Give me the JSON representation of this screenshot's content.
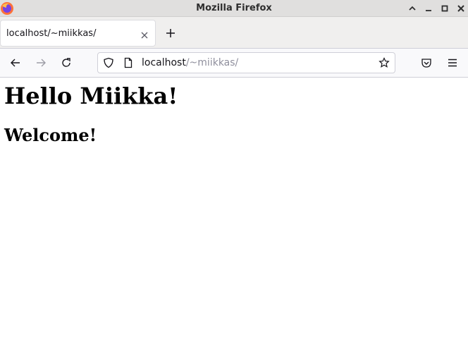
{
  "window": {
    "title": "Mozilla Firefox",
    "app_icon": "firefox-logo-icon",
    "controls": [
      "minimize-icon",
      "maximize-icon",
      "close-icon"
    ]
  },
  "tabs": [
    {
      "label": "localhost/~miikkas/",
      "active": true,
      "close_icon": "close-icon"
    }
  ],
  "new_tab_icon": "plus-icon",
  "toolbar": {
    "icons": [
      "back-arrow-icon",
      "forward-arrow-icon",
      "reload-icon",
      "pocket-icon",
      "hamburger-menu-icon"
    ]
  },
  "urlbar": {
    "host": "localhost",
    "path": "/~miikkas/",
    "icons": [
      "shield-icon",
      "page-icon",
      "star-icon"
    ]
  },
  "page": {
    "heading": "Hello Miikka!",
    "subheading": "Welcome!"
  },
  "colors": {
    "titlebar": "#e0dfde",
    "tabbar": "#f0efee",
    "navbar": "#f9f9fb",
    "url_path": "#8f8f9d"
  }
}
